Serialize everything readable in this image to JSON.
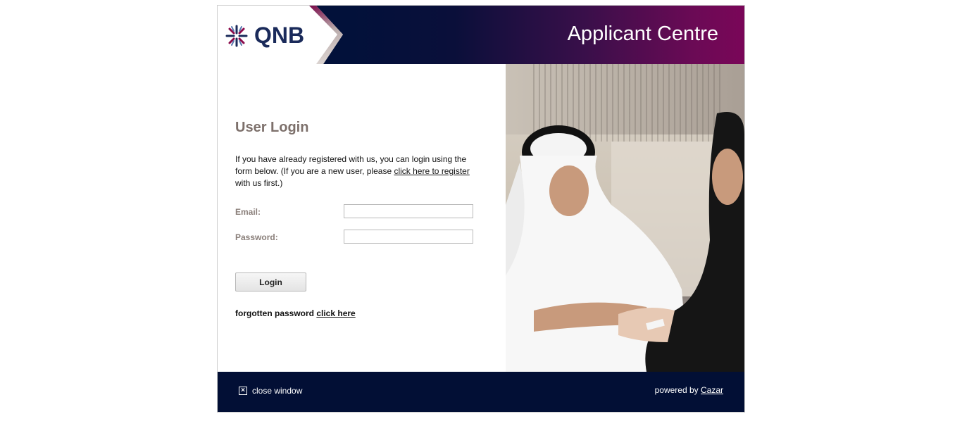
{
  "header": {
    "brand": "QNB",
    "title": "Applicant Centre"
  },
  "login": {
    "title": "User Login",
    "intro_before": "If you have already registered with us, you can login using the form below. (If you are a new user, please ",
    "register_link": "click here to register",
    "intro_after": " with us first.)",
    "email_label": "Email:",
    "email_value": "",
    "password_label": "Password:",
    "password_value": "",
    "login_button": "Login",
    "forgot_text": "forgotten password ",
    "forgot_link": "click here"
  },
  "footer": {
    "close_label": "close window",
    "powered_by": "powered by ",
    "powered_link": "Cazar"
  },
  "colors": {
    "header_dark": "#02103a",
    "header_accent": "#7a0658",
    "footer_bg": "#020f35",
    "title_gray": "#7d706b"
  },
  "icons": {
    "brand_mark": "qnb-star-icon",
    "close": "close-box-icon"
  }
}
